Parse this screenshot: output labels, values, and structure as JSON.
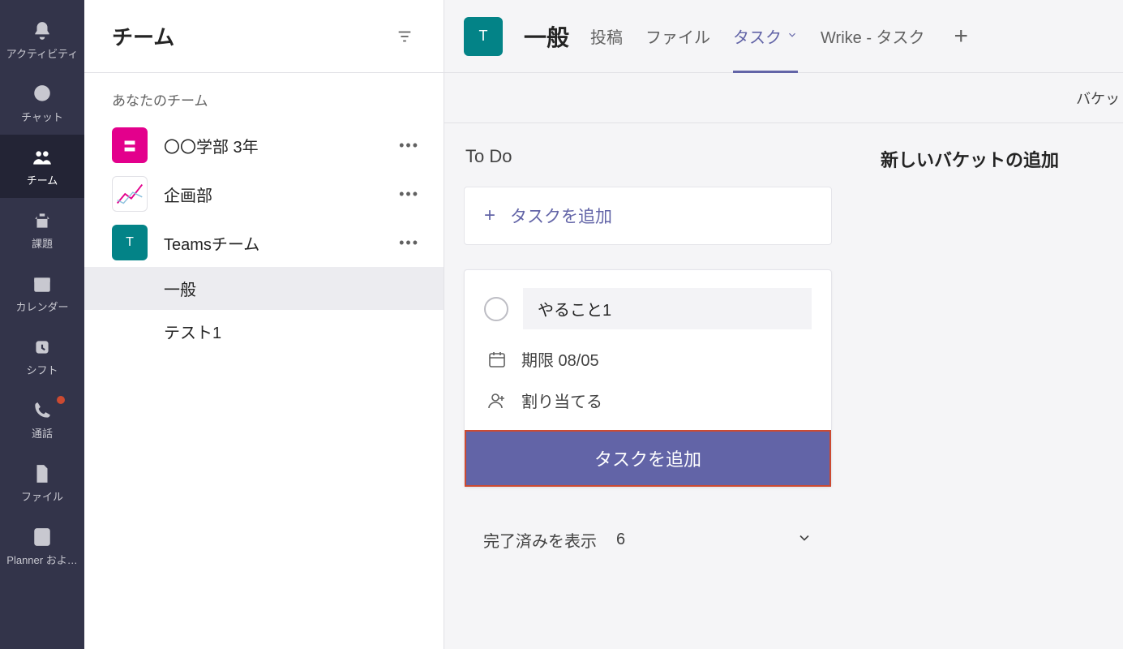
{
  "rail": {
    "items": [
      {
        "id": "activity",
        "label": "アクティビティ"
      },
      {
        "id": "chat",
        "label": "チャット"
      },
      {
        "id": "teams",
        "label": "チーム"
      },
      {
        "id": "assignments",
        "label": "課題"
      },
      {
        "id": "calendar",
        "label": "カレンダー"
      },
      {
        "id": "shifts",
        "label": "シフト"
      },
      {
        "id": "calls",
        "label": "通話"
      },
      {
        "id": "files",
        "label": "ファイル"
      },
      {
        "id": "planner",
        "label": "Planner およ…"
      }
    ],
    "active": "teams"
  },
  "teamsPanel": {
    "title": "チーム",
    "sectionLabel": "あなたのチーム",
    "teams": [
      {
        "avatarClass": "magenta",
        "avatarText": "〓",
        "name": "〇〇学部 3年",
        "channels": []
      },
      {
        "avatarClass": "chart",
        "avatarText": "",
        "name": "企画部",
        "channels": []
      },
      {
        "avatarClass": "teal",
        "avatarText": "T",
        "name": "Teamsチーム",
        "channels": [
          {
            "name": "一般",
            "active": true
          },
          {
            "name": "テスト1",
            "active": false
          }
        ]
      }
    ]
  },
  "mainHeader": {
    "channelAvatar": "T",
    "channelTitle": "一般",
    "tabs": [
      {
        "label": "投稿",
        "active": false,
        "hasChevron": false
      },
      {
        "label": "ファイル",
        "active": false,
        "hasChevron": false
      },
      {
        "label": "タスク",
        "active": true,
        "hasChevron": true
      },
      {
        "label": "Wrike - タスク",
        "active": false,
        "hasChevron": false
      }
    ]
  },
  "toolbar": {
    "groupBy": "バケットでグループ化"
  },
  "board": {
    "buckets": [
      {
        "title": "To Do",
        "addTaskLabel": "タスクを追加",
        "newTask": {
          "title": "やること1",
          "dueLabel": "期限 08/05",
          "assignLabel": "割り当てる",
          "submitLabel": "タスクを追加"
        },
        "completed": {
          "label": "完了済みを表示",
          "count": "6"
        }
      }
    ],
    "newBucketLabel": "新しいバケットの追加"
  },
  "colors": {
    "accent": "#6264a7",
    "teal": "#038387",
    "magenta": "#e3008c",
    "highlightBorder": "#cc4a31"
  }
}
